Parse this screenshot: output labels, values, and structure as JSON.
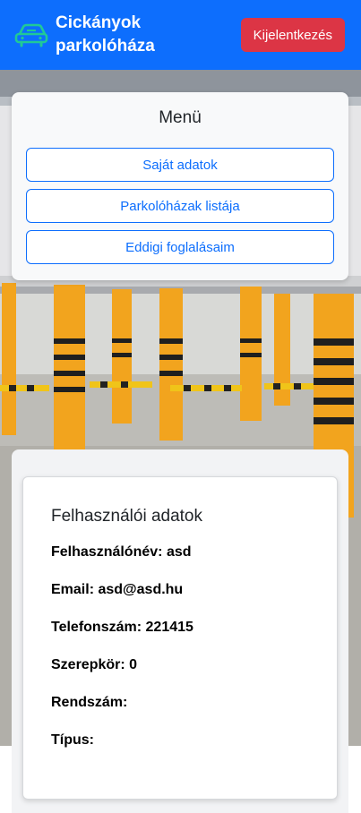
{
  "header": {
    "brand_title": "Cickányok parkolóháza",
    "brand_icon": "car-icon",
    "logout_label": "Kijelentkezés",
    "colors": {
      "navbar": "#0d6efd",
      "logout": "#dc3545",
      "icon": "#20c997"
    }
  },
  "menu": {
    "title": "Menü",
    "items": [
      {
        "label": "Saját adatok"
      },
      {
        "label": "Parkolóházak listája"
      },
      {
        "label": "Eddigi foglalásaim"
      }
    ]
  },
  "user_data": {
    "title": "Felhasználói adatok",
    "fields": [
      {
        "label": "Felhasználónév:",
        "value": "asd"
      },
      {
        "label": "Email:",
        "value": "asd@asd.hu"
      },
      {
        "label": "Telefonszám:",
        "value": "221415"
      },
      {
        "label": "Szerepkör:",
        "value": "0"
      },
      {
        "label": "Rendszám:",
        "value": ""
      },
      {
        "label": "Típus:",
        "value": ""
      }
    ]
  }
}
